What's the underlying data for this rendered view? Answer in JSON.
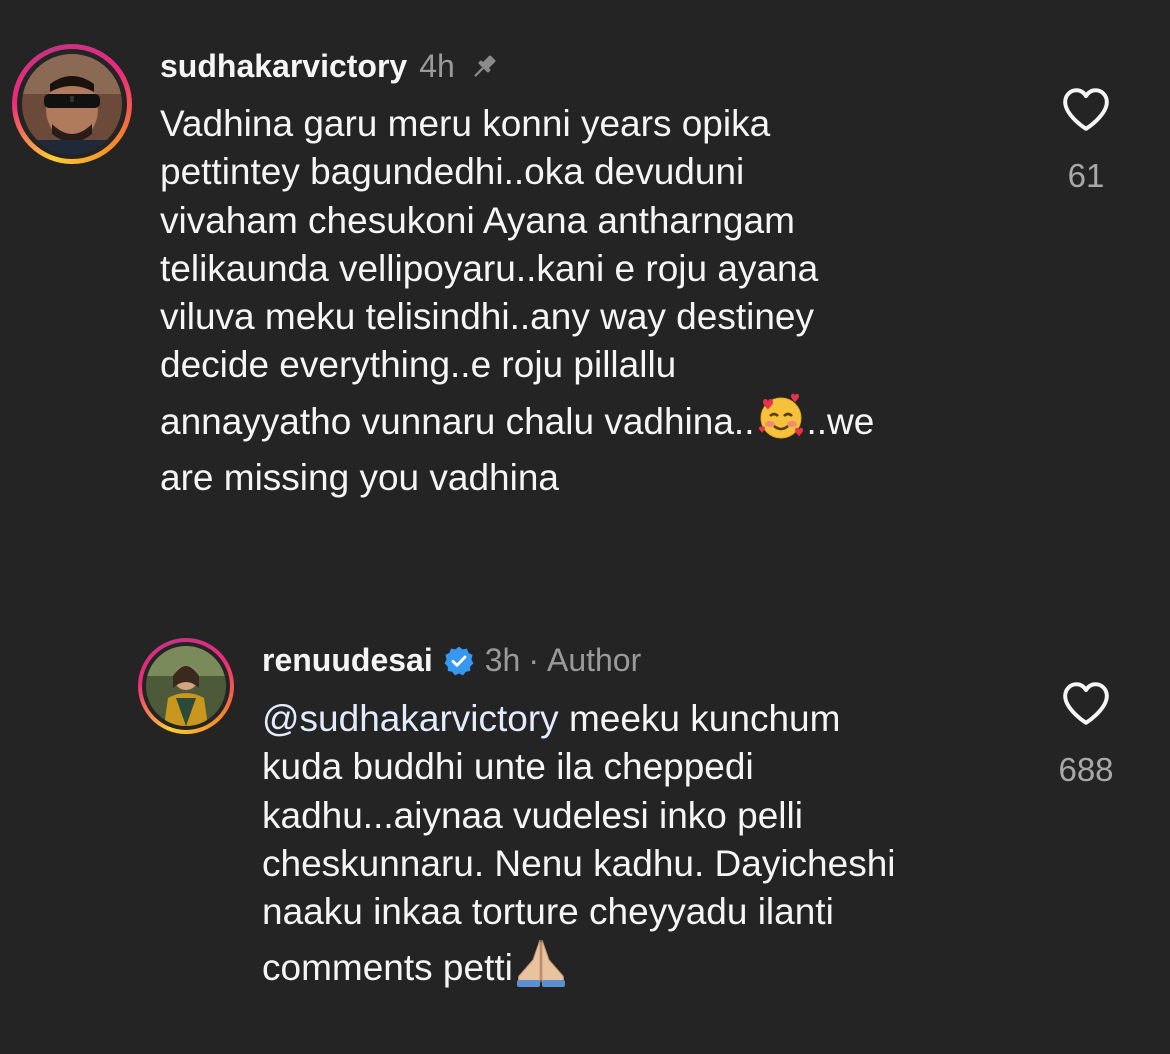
{
  "comments": [
    {
      "username": "sudhakarvictory",
      "time": "4h",
      "pinned_icon": "pin-icon",
      "text_part1": "Vadhina garu meru konni years opika\npettintey bagundedhi..oka devuduni\nvivaham chesukoni Ayana antharngam\ntelikaunda vellipoyaru..kani e roju ayana\nviluva meku telisindhi..any way destiney\ndecide everything..e roju pillallu\nannayyatho vunnaru chalu vadhina..",
      "emoji": "smiling-face-with-hearts",
      "text_part2": "..we\nare missing you vadhina",
      "likes": "61",
      "like_icon": "heart-outline-icon"
    },
    {
      "username": "renuudesai",
      "verified_icon": "verified-badge-icon",
      "time": "3h",
      "separator": "·",
      "author_label": "Author",
      "mention": "@sudhakarvictory",
      "text_part1": " meeku kunchum\nkuda buddhi unte ila cheppedi\nkadhu...aiynaa vudelesi inko pelli\ncheskunnaru. Nenu kadhu. Dayicheshi\nnaaku inkaa torture cheyyadu ilanti\ncomments petti",
      "emoji": "folded-hands",
      "likes": "688",
      "like_icon": "heart-outline-icon"
    }
  ],
  "colors": {
    "background": "#242424",
    "text": "#f5f5f5",
    "muted": "#9a9a9a",
    "verified": "#3897f0"
  }
}
